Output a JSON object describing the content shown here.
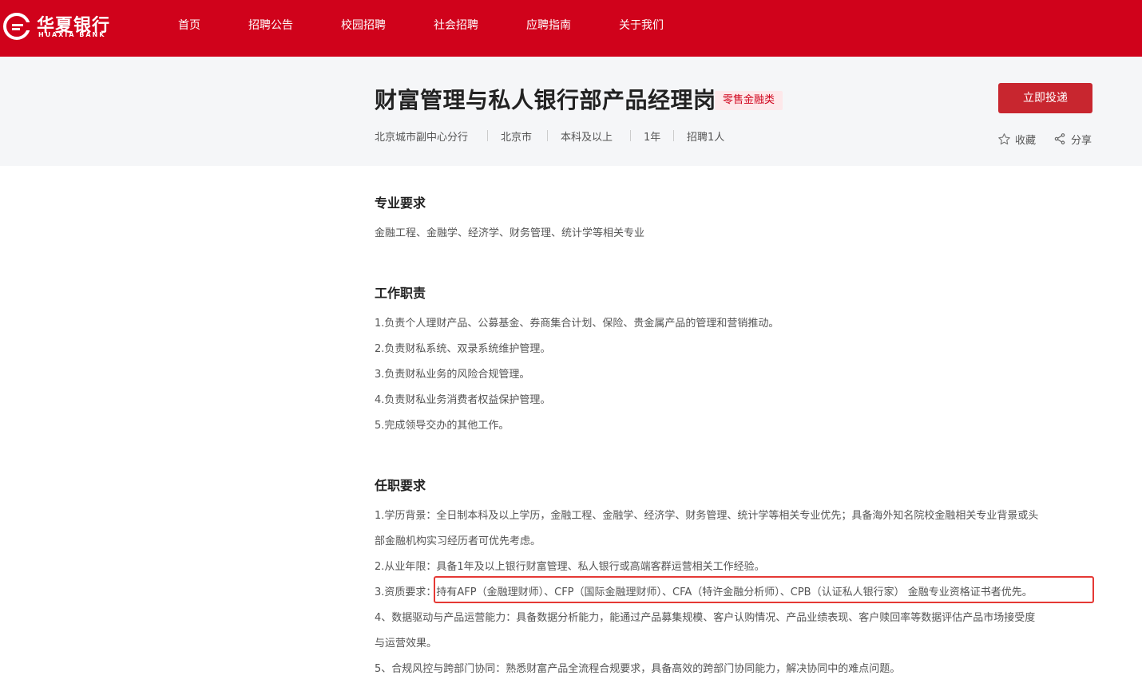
{
  "brand": {
    "name_cn": "华夏银行",
    "name_en": "HUAXIA BANK",
    "color": "#d0021b"
  },
  "nav": {
    "items": [
      "首页",
      "招聘公告",
      "校园招聘",
      "社会招聘",
      "应聘指南",
      "关于我们"
    ],
    "active": "社会招聘"
  },
  "job": {
    "title": "财富管理与私人银行部产品经理岗",
    "tag": "零售金融类",
    "meta": [
      "北京城市副中心分行",
      "北京市",
      "本科及以上",
      "1年",
      "招聘1人"
    ],
    "apply_label": "立即投递",
    "favorite_label": "收藏",
    "share_label": "分享"
  },
  "sections": {
    "major": {
      "title": "专业要求",
      "lines": [
        "金融工程、金融学、经济学、财务管理、统计学等相关专业"
      ]
    },
    "duties": {
      "title": "工作职责",
      "lines": [
        "1.负责个人理财产品、公募基金、券商集合计划、保险、贵金属产品的管理和营销推动。",
        "2.负责财私系统、双录系统维护管理。",
        "3.负责财私业务的风险合规管理。",
        "4.负责财私业务消费者权益保护管理。",
        "5.完成领导交办的其他工作。"
      ]
    },
    "requirements": {
      "title": "任职要求",
      "lines": [
        "1.学历背景：全日制本科及以上学历，金融工程、金融学、经济学、财务管理、统计学等相关专业优先；具备海外知名院校金融相关专业背景或头",
        "部金融机构实习经历者可优先考虑。",
        "2.从业年限：具备1年及以上银行财富管理、私人银行或高端客群运营相关工作经验。",
        "3.资质要求：持有AFP（金融理财师）、CFP（国际金融理财师）、CFA（特许金融分析师）、CPB（认证私人银行家） 金融专业资格证书者优先。",
        "4、数据驱动与产品运营能力：具备数据分析能力，能通过产品募集规模、客户认购情况、产品业绩表现、客户赎回率等数据评估产品市场接受度",
        "与运营效果。",
        "5、合规风控与跨部门协同：熟悉财富产品全流程合规要求，具备高效的跨部门协同能力，解决协同中的难点问题。"
      ]
    }
  }
}
